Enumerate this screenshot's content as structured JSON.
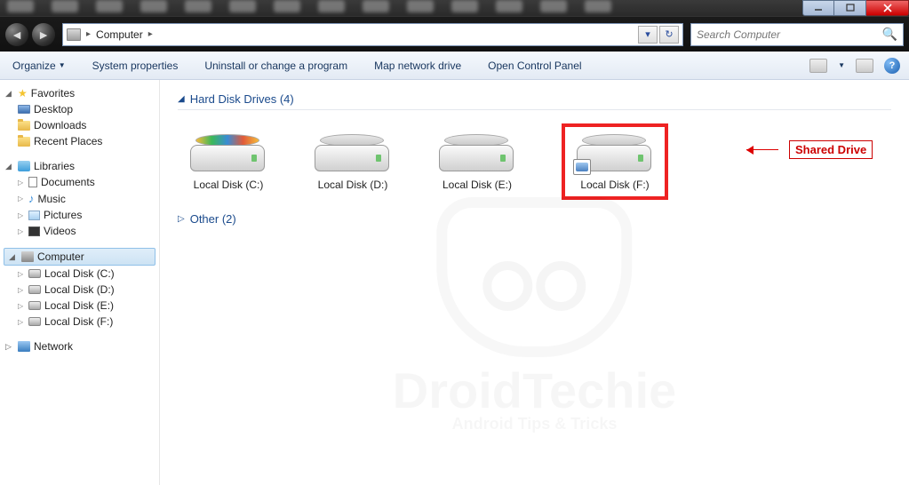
{
  "address": {
    "root": "Computer"
  },
  "search": {
    "placeholder": "Search Computer"
  },
  "toolbar": {
    "organize": "Organize",
    "system_properties": "System properties",
    "uninstall": "Uninstall or change a program",
    "map_drive": "Map network drive",
    "control_panel": "Open Control Panel"
  },
  "sidebar": {
    "favorites": {
      "label": "Favorites",
      "items": [
        "Desktop",
        "Downloads",
        "Recent Places"
      ]
    },
    "libraries": {
      "label": "Libraries",
      "items": [
        "Documents",
        "Music",
        "Pictures",
        "Videos"
      ]
    },
    "computer": {
      "label": "Computer",
      "items": [
        "Local Disk (C:)",
        "Local Disk (D:)",
        "Local Disk (E:)",
        "Local Disk (F:)"
      ]
    },
    "network": {
      "label": "Network"
    }
  },
  "main": {
    "groups": [
      {
        "label": "Hard Disk Drives (4)",
        "expanded": true
      },
      {
        "label": "Other (2)",
        "expanded": false
      }
    ],
    "drives": [
      {
        "label": "Local Disk (C:)",
        "os": true,
        "shared": false
      },
      {
        "label": "Local Disk (D:)",
        "os": false,
        "shared": false
      },
      {
        "label": "Local Disk (E:)",
        "os": false,
        "shared": false
      },
      {
        "label": "Local Disk (F:)",
        "os": false,
        "shared": true
      }
    ]
  },
  "annotation": {
    "label": "Shared Drive"
  },
  "watermark": {
    "main": "DroidTechie",
    "sub": "Android Tips & Tricks"
  }
}
